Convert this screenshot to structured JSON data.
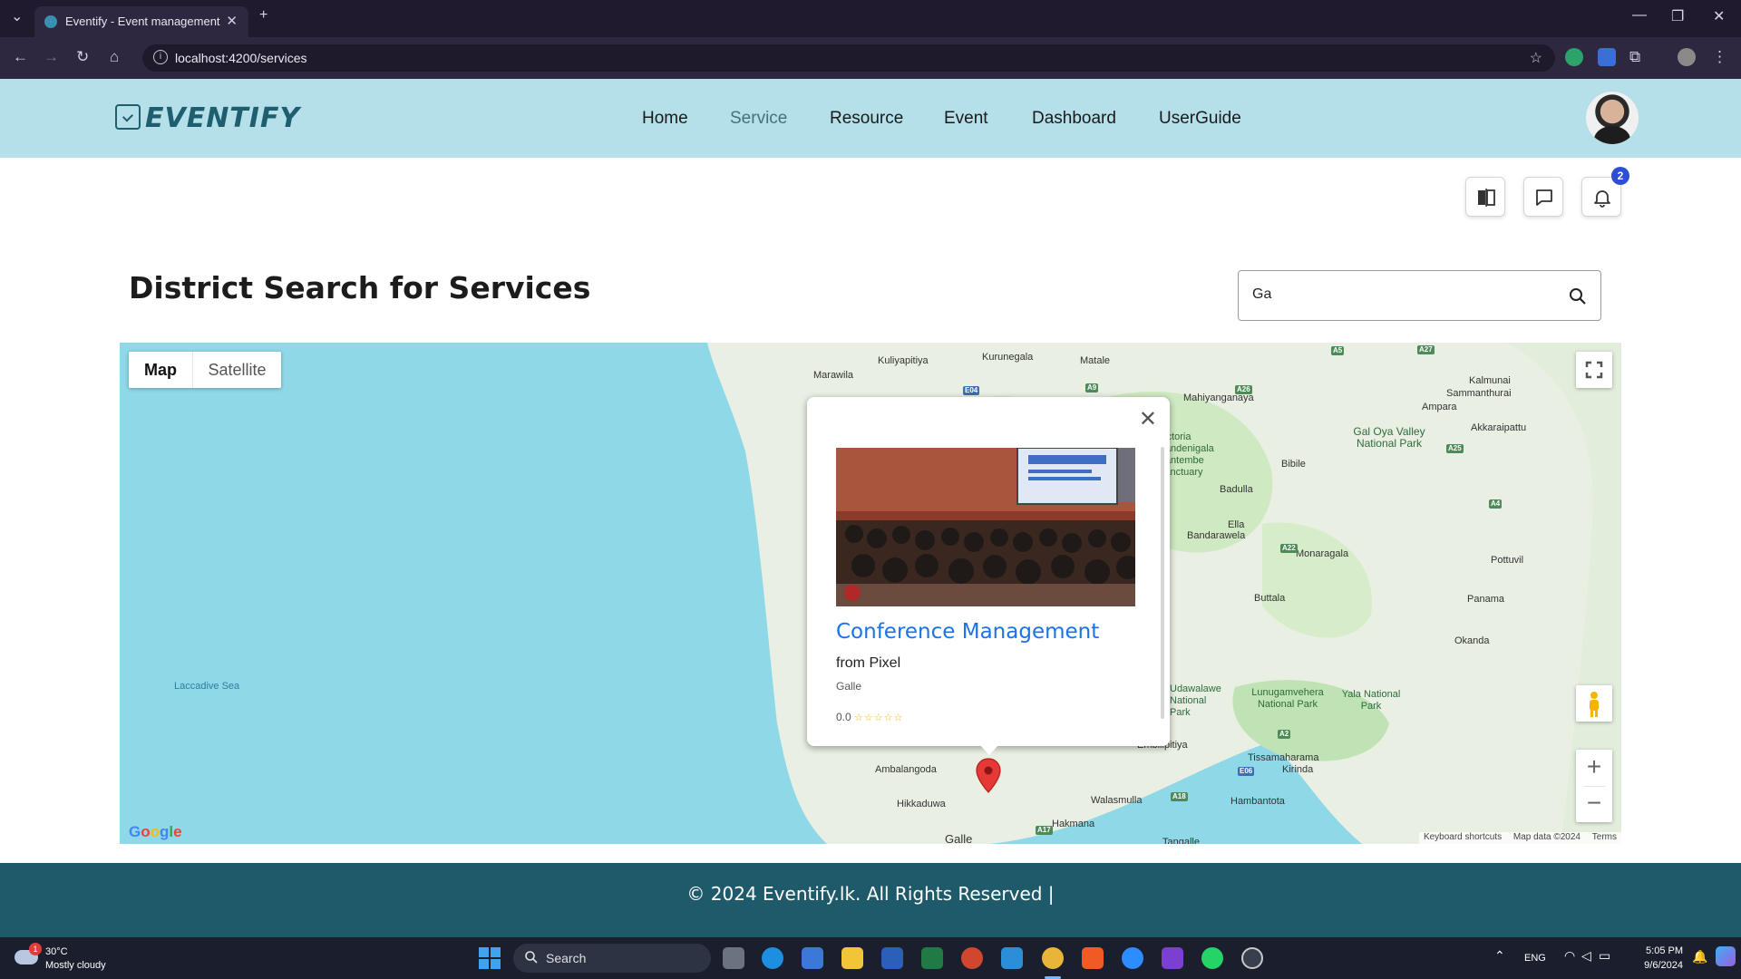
{
  "browser": {
    "tab_title": "Eventify - Event management s",
    "url": "localhost:4200/services"
  },
  "header": {
    "logo_text": "EVENTIFY",
    "nav": [
      {
        "label": "Home",
        "active": false
      },
      {
        "label": "Service",
        "active": true
      },
      {
        "label": "Resource",
        "active": false
      },
      {
        "label": "Event",
        "active": false
      },
      {
        "label": "Dashboard",
        "active": false
      },
      {
        "label": "UserGuide",
        "active": false
      }
    ]
  },
  "actions": {
    "notification_count": "2"
  },
  "page": {
    "title": "District Search for Services",
    "search_value": "Ga"
  },
  "map": {
    "type_options": [
      "Map",
      "Satellite"
    ],
    "selected_type": "Map",
    "sea_label": "Laccadive Sea",
    "place_labels": [
      "Kuliyapitiya",
      "Kurunegala",
      "Matale",
      "Marawila",
      "Mahiyanganaya",
      "Kalmunai",
      "Sammanthurai",
      "Ampara",
      "Akkaraipattu",
      "Bibile",
      "Badulla",
      "Ella",
      "Bandarawela",
      "Monaragala",
      "Pottuvil",
      "Buttala",
      "Panama",
      "Okanda",
      "Tissamaharama",
      "Kirinda",
      "Embilipitiya",
      "Ambalangoda",
      "Hikkaduwa",
      "Walasmulla",
      "Hambantota",
      "Hakmana",
      "Galle",
      "Tangalle"
    ],
    "park_labels": [
      "Gal Oya Valley National Park",
      "Victoria Randenigala Rantembe Sanctuary",
      "Lunugamvehera National Park",
      "Yala National Park",
      "Udawalawe National Park"
    ],
    "road_labels": [
      "A5",
      "A27",
      "E04",
      "A9",
      "A26",
      "A25",
      "A4",
      "A22",
      "A17",
      "A18",
      "A2",
      "E06"
    ],
    "attribution": [
      "Keyboard shortcuts",
      "Map data ©2024",
      "Terms"
    ],
    "google_logo": "Google"
  },
  "info_window": {
    "name": "Conference Management",
    "from": "from Pixel",
    "location": "Galle",
    "rating": "0.0",
    "stars": "☆☆☆☆☆"
  },
  "footer": {
    "text": "© 2024 Eventify.lk. All Rights Reserved |"
  },
  "taskbar": {
    "weather_temp": "30°C",
    "weather_desc": "Mostly cloudy",
    "weather_badge": "1",
    "search_label": "Search",
    "language": "ENG",
    "time": "5:05 PM",
    "date": "9/6/2024"
  },
  "colors": {
    "header_bg": "#b5e0ea",
    "brand": "#1f5e6e",
    "footer_bg": "#1f5a6b",
    "link_blue": "#1a73e8",
    "map_water": "#8fd8e8",
    "map_land": "#e9efe3",
    "map_park": "#bfe3b4"
  }
}
